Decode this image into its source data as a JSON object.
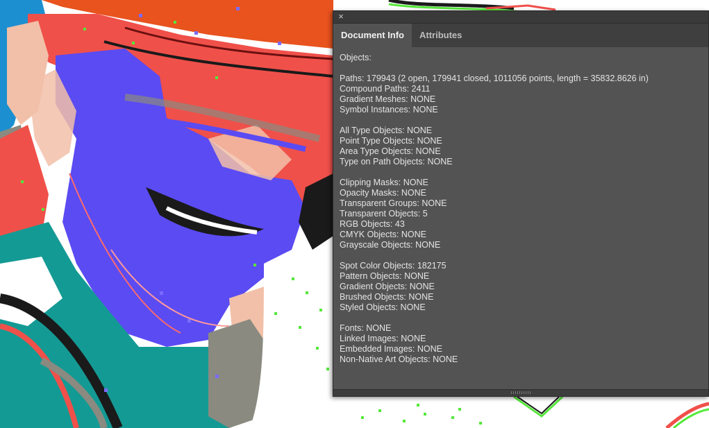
{
  "panel": {
    "close_glyph": "×",
    "tabs": [
      {
        "label": "Document Info",
        "active": true
      },
      {
        "label": "Attributes",
        "active": false
      }
    ],
    "lines": [
      "Objects:",
      "",
      "Paths: 179943 (2 open, 179941 closed, 1011056 points, length = 35832.8626 in)",
      "Compound Paths: 2411",
      "Gradient Meshes: NONE",
      "Symbol Instances: NONE",
      "",
      "All Type Objects: NONE",
      "Point Type Objects: NONE",
      "Area Type Objects: NONE",
      "Type on Path Objects: NONE",
      "",
      "Clipping Masks: NONE",
      "Opacity Masks: NONE",
      "Transparent Groups: NONE",
      "Transparent Objects: 5",
      "RGB Objects: 43",
      "CMYK Objects: NONE",
      "Grayscale Objects: NONE",
      "",
      "Spot Color Objects: 182175",
      "Pattern Objects: NONE",
      "Gradient Objects: NONE",
      "Brushed Objects: NONE",
      "Styled Objects: NONE",
      "",
      "Fonts: NONE",
      "Linked Images: NONE",
      "Embedded Images: NONE",
      "Non-Native Art Objects: NONE"
    ]
  },
  "colors": {
    "panel_bg": "#535353",
    "panel_tab_bar": "#3f3f3f",
    "panel_text": "#e4e4e4",
    "art_red": "#f0504a",
    "art_orange": "#e8531e",
    "art_blue": "#5b4bf2",
    "art_teal": "#149a94",
    "art_peach": "#f2c0a8",
    "art_gray": "#8a8a80",
    "art_green": "#55e83a",
    "art_black": "#1a1a1a",
    "art_cyan": "#1c8fd0"
  }
}
